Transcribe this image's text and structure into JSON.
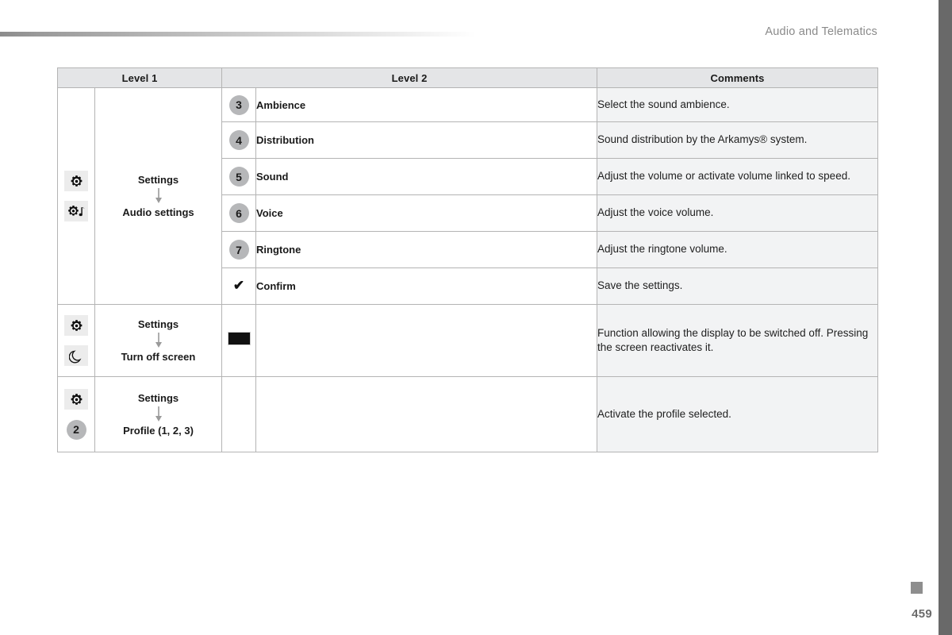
{
  "header": {
    "title": "Audio and Telematics"
  },
  "table": {
    "columns": [
      "Level 1",
      "Level 2",
      "Comments"
    ],
    "groups": [
      {
        "icons": [
          "gear-icon",
          "gear-music-icon"
        ],
        "level1_primary": "Settings",
        "level1_secondary": "Audio settings",
        "rows": [
          {
            "badge": "3",
            "badge_type": "number",
            "level2": "Ambience",
            "comment": "Select the sound ambience."
          },
          {
            "badge": "4",
            "badge_type": "number",
            "level2": "Distribution",
            "comment": "Sound distribution by the Arkamys® system."
          },
          {
            "badge": "5",
            "badge_type": "number",
            "level2": "Sound",
            "comment": "Adjust the volume or activate volume linked to speed."
          },
          {
            "badge": "6",
            "badge_type": "number",
            "level2": "Voice",
            "comment": "Adjust the voice volume."
          },
          {
            "badge": "7",
            "badge_type": "number",
            "level2": "Ringtone",
            "comment": "Adjust the ringtone volume."
          },
          {
            "badge": "✔",
            "badge_type": "check",
            "level2": "Confirm",
            "comment": "Save the settings."
          }
        ]
      },
      {
        "icons": [
          "gear-icon",
          "moon-icon"
        ],
        "level1_primary": "Settings",
        "level1_secondary": "Turn off screen",
        "rows": [
          {
            "badge": "",
            "badge_type": "screen",
            "level2": "",
            "comment": "Function allowing the display to be switched off. Pressing the screen reactivates it."
          }
        ]
      },
      {
        "icons": [
          "gear-icon",
          "badge-2-icon"
        ],
        "level1_primary": "Settings",
        "level1_secondary": "Profile (1, 2, 3)",
        "rows": [
          {
            "badge": "",
            "badge_type": "none",
            "level2": "",
            "comment": "Activate the profile selected."
          }
        ]
      }
    ]
  },
  "footer": {
    "page_number": "459"
  },
  "colors": {
    "header_rule": "#8c8c8c",
    "edge_bar": "#696969",
    "table_header_bg": "#e4e5e7",
    "comment_bg": "#f2f3f4",
    "badge_bg": "#b6b7b9",
    "border": "#b4b4b4",
    "title_text": "#8a8a8a"
  }
}
